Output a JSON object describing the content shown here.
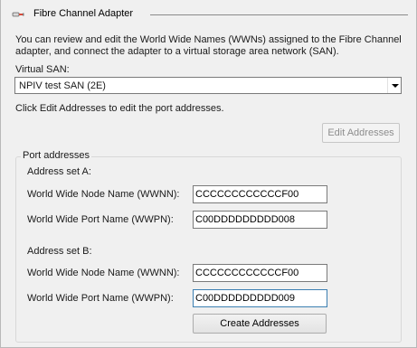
{
  "header": {
    "icon": "fibre-channel-adapter-icon",
    "title": "Fibre Channel Adapter"
  },
  "description": "You can review and edit the World Wide Names (WWNs) assigned to the Fibre Channel adapter, and connect the adapter to a virtual storage area network (SAN).",
  "virtual_san": {
    "label": "Virtual SAN:",
    "selected": "NPIV test SAN (2E)"
  },
  "edit_hint": "Click Edit Addresses to edit the port addresses.",
  "edit_addresses_button": "Edit Addresses",
  "port_addresses": {
    "legend": "Port addresses",
    "set_a": {
      "label": "Address set A:",
      "wwnn_label": "World Wide Node Name (WWNN):",
      "wwnn_value": "CCCCCCCCCCCCF00",
      "wwpn_label": "World Wide Port Name (WWPN):",
      "wwpn_value": "C00DDDDDDDDD008"
    },
    "set_b": {
      "label": "Address set B:",
      "wwnn_label": "World Wide Node Name (WWNN):",
      "wwnn_value": "CCCCCCCCCCCCF00",
      "wwpn_label": "World Wide Port Name (WWPN):",
      "wwpn_value": "C00DDDDDDDDD009"
    }
  },
  "create_addresses_button": "Create Addresses"
}
